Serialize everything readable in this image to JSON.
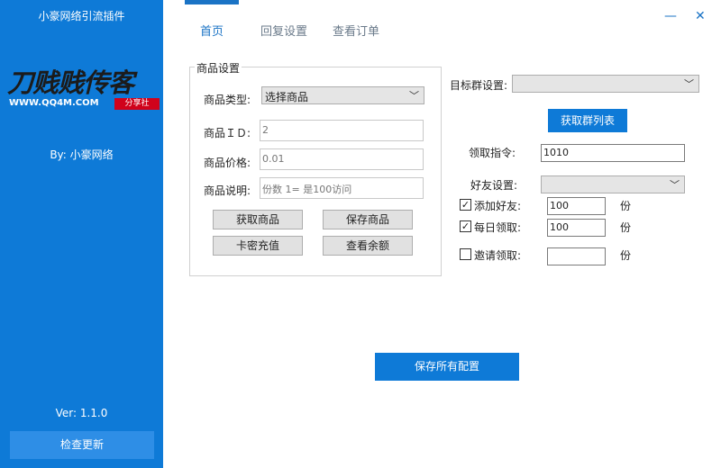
{
  "sidebar": {
    "app_title": "小豪网络引流插件",
    "logo_main": "刀贱贱传客",
    "logo_sub": "WWW.QQ4M.COM",
    "logo_tag": "分享社",
    "by": "By: 小豪网络",
    "version": "Ver: 1.1.0",
    "update_button": "检查更新"
  },
  "tabs": [
    "首页",
    "回复设置",
    "查看订单"
  ],
  "window": {
    "minimize": "—",
    "close": "✕"
  },
  "product": {
    "group_title": "商品设置",
    "type_label": "商品类型:",
    "type_value": "选择商品",
    "id_label": "商品ＩＤ:",
    "id_value": "2",
    "price_label": "商品价格:",
    "price_value": "0.01",
    "desc_label": "商品说明:",
    "desc_value": "份数 1= 是100访问",
    "buttons": [
      "获取商品",
      "保存商品",
      "卡密充值",
      "查看余额"
    ]
  },
  "target": {
    "group_label": "目标群设置:",
    "group_value": "",
    "get_groups_button": "获取群列表",
    "command_label": "领取指令:",
    "command_value": "1010",
    "friend_label": "好友设置:",
    "friend_value": "",
    "options": [
      {
        "label": "添加好友:",
        "checked": true,
        "value": "100",
        "unit": "份"
      },
      {
        "label": "每日领取:",
        "checked": true,
        "value": "100",
        "unit": "份"
      },
      {
        "label": "邀请领取:",
        "checked": false,
        "value": "",
        "unit": "份"
      }
    ]
  },
  "save_all_button": "保存所有配置"
}
